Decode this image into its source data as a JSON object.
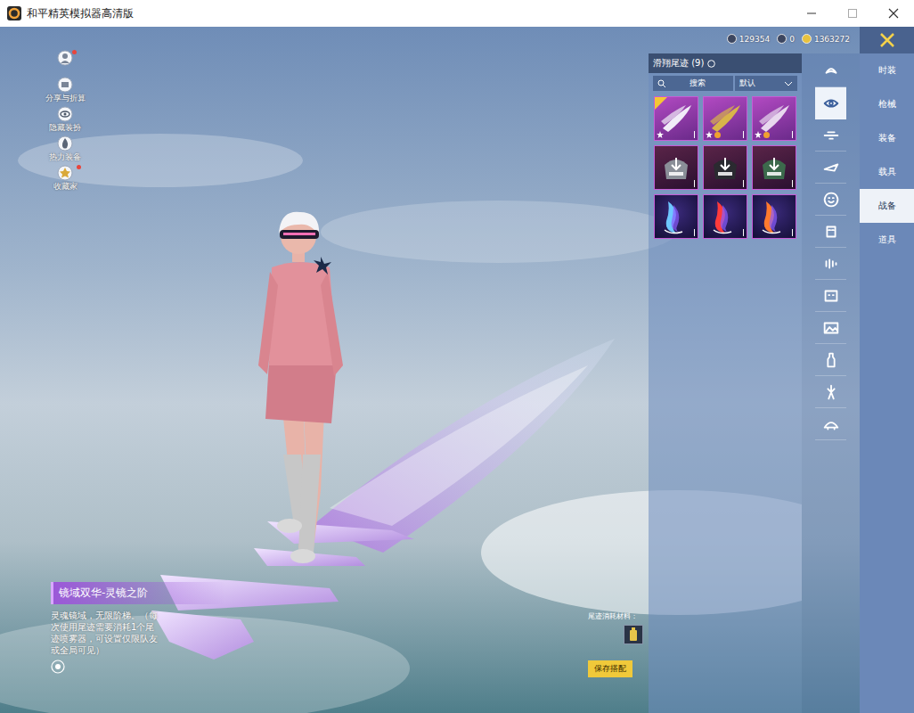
{
  "window": {
    "title": "和平精英模拟器高清版"
  },
  "currencies": [
    {
      "amount": "129354"
    },
    {
      "amount": "0"
    },
    {
      "amount": "1363272"
    }
  ],
  "shortcuts": [
    {
      "kind": "avatar",
      "label": "",
      "badge": true
    },
    {
      "kind": "share",
      "label": "分享与折算",
      "badge": false
    },
    {
      "kind": "eye",
      "label": "隐藏装扮",
      "badge": false
    },
    {
      "kind": "fire",
      "label": "热力装备",
      "badge": false
    },
    {
      "kind": "medal",
      "label": "收藏家",
      "badge": true
    }
  ],
  "panel": {
    "title": "滑翔尾迹 (9)",
    "search_placeholder": "搜索",
    "sort": "默认"
  },
  "items": [
    {
      "kind": "owned",
      "equipped": true,
      "starred": true,
      "upgradable": false,
      "color": "#f1ecf8"
    },
    {
      "kind": "owned",
      "equipped": false,
      "starred": true,
      "upgradable": true,
      "color": "#d8b44a"
    },
    {
      "kind": "owned",
      "equipped": false,
      "starred": true,
      "upgradable": true,
      "color": "#e8d8ee"
    },
    {
      "kind": "download",
      "equipped": false,
      "starred": false,
      "upgradable": false,
      "color": "#8a8f98"
    },
    {
      "kind": "download",
      "equipped": false,
      "starred": false,
      "upgradable": false,
      "color": "#2a2a30"
    },
    {
      "kind": "download",
      "equipped": false,
      "starred": false,
      "upgradable": false,
      "color": "#3c6a4c"
    },
    {
      "kind": "trail",
      "equipped": false,
      "starred": false,
      "upgradable": false,
      "color": "#6ec7ff"
    },
    {
      "kind": "trail",
      "equipped": false,
      "starred": false,
      "upgradable": false,
      "color": "#ff3b3b"
    },
    {
      "kind": "trail",
      "equipped": false,
      "starred": false,
      "upgradable": false,
      "color": "#ff7a2e"
    }
  ],
  "categories": [
    {
      "selected": false
    },
    {
      "selected": true
    },
    {
      "selected": false
    },
    {
      "selected": false
    },
    {
      "selected": false
    },
    {
      "selected": false
    },
    {
      "selected": false
    },
    {
      "selected": false
    },
    {
      "selected": false
    },
    {
      "selected": false
    },
    {
      "selected": false
    },
    {
      "selected": false
    }
  ],
  "tabs": [
    {
      "label": "时装",
      "selected": false
    },
    {
      "label": "枪械",
      "selected": false
    },
    {
      "label": "装备",
      "selected": false
    },
    {
      "label": "载具",
      "selected": false
    },
    {
      "label": "战备",
      "selected": true
    },
    {
      "label": "道具",
      "selected": false
    }
  ],
  "selected_item": {
    "name": "镜域双华-灵镜之阶",
    "description": "灵魂镜域，无限阶梯。（每次使用尾迹需要消耗1个尾迹喷雾器，可设置仅限队友或全局可见）"
  },
  "cost": {
    "label": "尾迹消耗材料："
  },
  "save_button": "保存搭配"
}
